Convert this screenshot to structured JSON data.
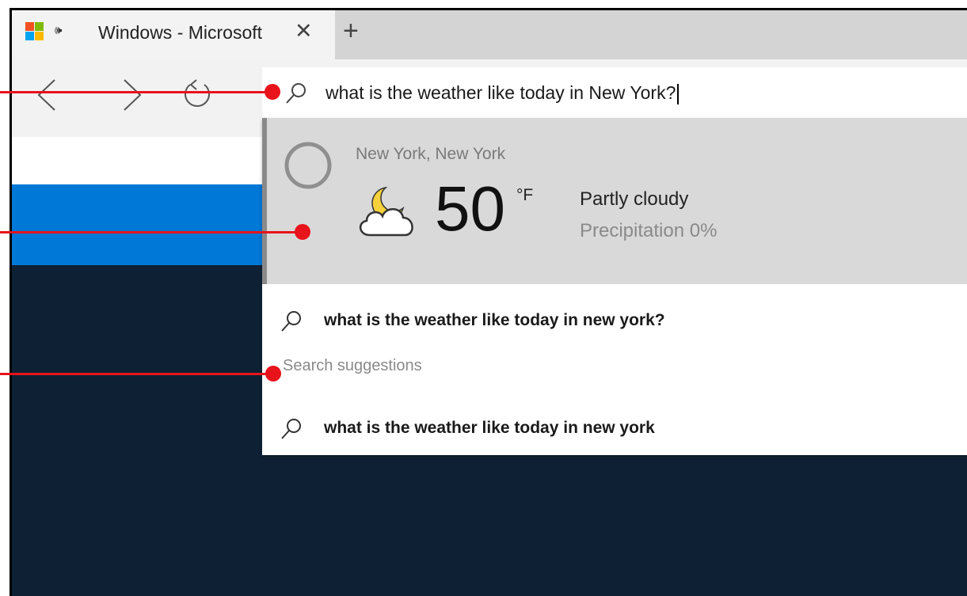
{
  "browser": {
    "tab": {
      "title": "Windows - Microsoft",
      "icon": "microsoft-logo",
      "audio_icon": "🕪",
      "close_glyph": "✕"
    },
    "new_tab_glyph": "+",
    "address_bar": {
      "value": "what is the weather like today in New York?",
      "icon": "search-icon"
    }
  },
  "dropdown": {
    "weather": {
      "location": "New York, New York",
      "temperature": "50",
      "unit": "°F",
      "condition": "Partly cloudy",
      "precipitation": "Precipitation 0%",
      "icon": "partly-cloudy-night-icon"
    },
    "top_suggestion": "what is the weather like today in new york?",
    "section_title": "Search suggestions",
    "suggestions": [
      "what is the weather like today in new york"
    ]
  },
  "colors": {
    "accent": "#0078d7",
    "callout": "#e8131b",
    "page_background": "#0e2134"
  }
}
